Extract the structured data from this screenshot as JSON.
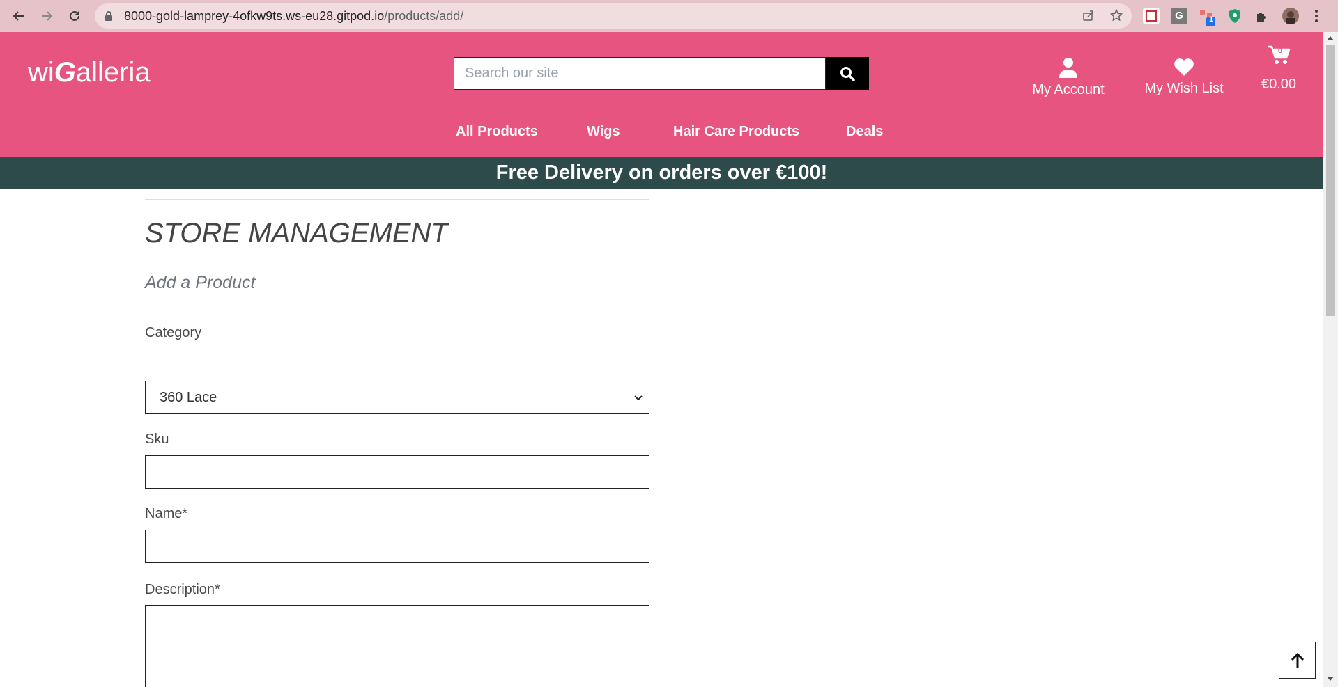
{
  "browser": {
    "url_domain": "8000-gold-lamprey-4ofkw9ts.ws-eu28.gitpod.io",
    "url_path": "/products/add/",
    "extension_badge": "1"
  },
  "header": {
    "brand_prefix": "wi",
    "brand_g": "G",
    "brand_suffix": "alleria",
    "search_placeholder": "Search our site",
    "account_label": "My Account",
    "wishlist_label": "My Wish List",
    "cart_total": "€0.00",
    "cart_count": "0"
  },
  "nav": {
    "items": [
      "All Products",
      "Wigs",
      "Hair Care Products",
      "Deals"
    ]
  },
  "promo": {
    "text": "Free Delivery on orders over €100!"
  },
  "page": {
    "title": "STORE MANAGEMENT",
    "subtitle": "Add a Product"
  },
  "form": {
    "category_label": "Category",
    "category_value": "360 Lace",
    "sku_label": "Sku",
    "name_label": "Name*",
    "description_label": "Description*"
  },
  "colors": {
    "brand_pink": "#e7547f",
    "promo_bg": "#2e4b4c"
  }
}
